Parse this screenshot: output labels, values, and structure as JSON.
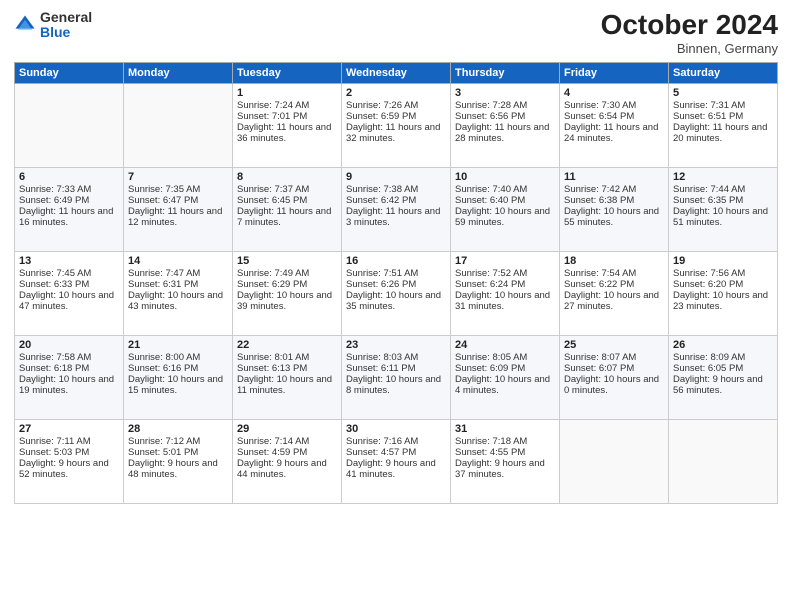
{
  "logo": {
    "general": "General",
    "blue": "Blue"
  },
  "header": {
    "month": "October 2024",
    "location": "Binnen, Germany"
  },
  "weekdays": [
    "Sunday",
    "Monday",
    "Tuesday",
    "Wednesday",
    "Thursday",
    "Friday",
    "Saturday"
  ],
  "weeks": [
    [
      {
        "day": "",
        "sunrise": "",
        "sunset": "",
        "daylight": ""
      },
      {
        "day": "",
        "sunrise": "",
        "sunset": "",
        "daylight": ""
      },
      {
        "day": "1",
        "sunrise": "Sunrise: 7:24 AM",
        "sunset": "Sunset: 7:01 PM",
        "daylight": "Daylight: 11 hours and 36 minutes."
      },
      {
        "day": "2",
        "sunrise": "Sunrise: 7:26 AM",
        "sunset": "Sunset: 6:59 PM",
        "daylight": "Daylight: 11 hours and 32 minutes."
      },
      {
        "day": "3",
        "sunrise": "Sunrise: 7:28 AM",
        "sunset": "Sunset: 6:56 PM",
        "daylight": "Daylight: 11 hours and 28 minutes."
      },
      {
        "day": "4",
        "sunrise": "Sunrise: 7:30 AM",
        "sunset": "Sunset: 6:54 PM",
        "daylight": "Daylight: 11 hours and 24 minutes."
      },
      {
        "day": "5",
        "sunrise": "Sunrise: 7:31 AM",
        "sunset": "Sunset: 6:51 PM",
        "daylight": "Daylight: 11 hours and 20 minutes."
      }
    ],
    [
      {
        "day": "6",
        "sunrise": "Sunrise: 7:33 AM",
        "sunset": "Sunset: 6:49 PM",
        "daylight": "Daylight: 11 hours and 16 minutes."
      },
      {
        "day": "7",
        "sunrise": "Sunrise: 7:35 AM",
        "sunset": "Sunset: 6:47 PM",
        "daylight": "Daylight: 11 hours and 12 minutes."
      },
      {
        "day": "8",
        "sunrise": "Sunrise: 7:37 AM",
        "sunset": "Sunset: 6:45 PM",
        "daylight": "Daylight: 11 hours and 7 minutes."
      },
      {
        "day": "9",
        "sunrise": "Sunrise: 7:38 AM",
        "sunset": "Sunset: 6:42 PM",
        "daylight": "Daylight: 11 hours and 3 minutes."
      },
      {
        "day": "10",
        "sunrise": "Sunrise: 7:40 AM",
        "sunset": "Sunset: 6:40 PM",
        "daylight": "Daylight: 10 hours and 59 minutes."
      },
      {
        "day": "11",
        "sunrise": "Sunrise: 7:42 AM",
        "sunset": "Sunset: 6:38 PM",
        "daylight": "Daylight: 10 hours and 55 minutes."
      },
      {
        "day": "12",
        "sunrise": "Sunrise: 7:44 AM",
        "sunset": "Sunset: 6:35 PM",
        "daylight": "Daylight: 10 hours and 51 minutes."
      }
    ],
    [
      {
        "day": "13",
        "sunrise": "Sunrise: 7:45 AM",
        "sunset": "Sunset: 6:33 PM",
        "daylight": "Daylight: 10 hours and 47 minutes."
      },
      {
        "day": "14",
        "sunrise": "Sunrise: 7:47 AM",
        "sunset": "Sunset: 6:31 PM",
        "daylight": "Daylight: 10 hours and 43 minutes."
      },
      {
        "day": "15",
        "sunrise": "Sunrise: 7:49 AM",
        "sunset": "Sunset: 6:29 PM",
        "daylight": "Daylight: 10 hours and 39 minutes."
      },
      {
        "day": "16",
        "sunrise": "Sunrise: 7:51 AM",
        "sunset": "Sunset: 6:26 PM",
        "daylight": "Daylight: 10 hours and 35 minutes."
      },
      {
        "day": "17",
        "sunrise": "Sunrise: 7:52 AM",
        "sunset": "Sunset: 6:24 PM",
        "daylight": "Daylight: 10 hours and 31 minutes."
      },
      {
        "day": "18",
        "sunrise": "Sunrise: 7:54 AM",
        "sunset": "Sunset: 6:22 PM",
        "daylight": "Daylight: 10 hours and 27 minutes."
      },
      {
        "day": "19",
        "sunrise": "Sunrise: 7:56 AM",
        "sunset": "Sunset: 6:20 PM",
        "daylight": "Daylight: 10 hours and 23 minutes."
      }
    ],
    [
      {
        "day": "20",
        "sunrise": "Sunrise: 7:58 AM",
        "sunset": "Sunset: 6:18 PM",
        "daylight": "Daylight: 10 hours and 19 minutes."
      },
      {
        "day": "21",
        "sunrise": "Sunrise: 8:00 AM",
        "sunset": "Sunset: 6:16 PM",
        "daylight": "Daylight: 10 hours and 15 minutes."
      },
      {
        "day": "22",
        "sunrise": "Sunrise: 8:01 AM",
        "sunset": "Sunset: 6:13 PM",
        "daylight": "Daylight: 10 hours and 11 minutes."
      },
      {
        "day": "23",
        "sunrise": "Sunrise: 8:03 AM",
        "sunset": "Sunset: 6:11 PM",
        "daylight": "Daylight: 10 hours and 8 minutes."
      },
      {
        "day": "24",
        "sunrise": "Sunrise: 8:05 AM",
        "sunset": "Sunset: 6:09 PM",
        "daylight": "Daylight: 10 hours and 4 minutes."
      },
      {
        "day": "25",
        "sunrise": "Sunrise: 8:07 AM",
        "sunset": "Sunset: 6:07 PM",
        "daylight": "Daylight: 10 hours and 0 minutes."
      },
      {
        "day": "26",
        "sunrise": "Sunrise: 8:09 AM",
        "sunset": "Sunset: 6:05 PM",
        "daylight": "Daylight: 9 hours and 56 minutes."
      }
    ],
    [
      {
        "day": "27",
        "sunrise": "Sunrise: 7:11 AM",
        "sunset": "Sunset: 5:03 PM",
        "daylight": "Daylight: 9 hours and 52 minutes."
      },
      {
        "day": "28",
        "sunrise": "Sunrise: 7:12 AM",
        "sunset": "Sunset: 5:01 PM",
        "daylight": "Daylight: 9 hours and 48 minutes."
      },
      {
        "day": "29",
        "sunrise": "Sunrise: 7:14 AM",
        "sunset": "Sunset: 4:59 PM",
        "daylight": "Daylight: 9 hours and 44 minutes."
      },
      {
        "day": "30",
        "sunrise": "Sunrise: 7:16 AM",
        "sunset": "Sunset: 4:57 PM",
        "daylight": "Daylight: 9 hours and 41 minutes."
      },
      {
        "day": "31",
        "sunrise": "Sunrise: 7:18 AM",
        "sunset": "Sunset: 4:55 PM",
        "daylight": "Daylight: 9 hours and 37 minutes."
      },
      {
        "day": "",
        "sunrise": "",
        "sunset": "",
        "daylight": ""
      },
      {
        "day": "",
        "sunrise": "",
        "sunset": "",
        "daylight": ""
      }
    ]
  ]
}
